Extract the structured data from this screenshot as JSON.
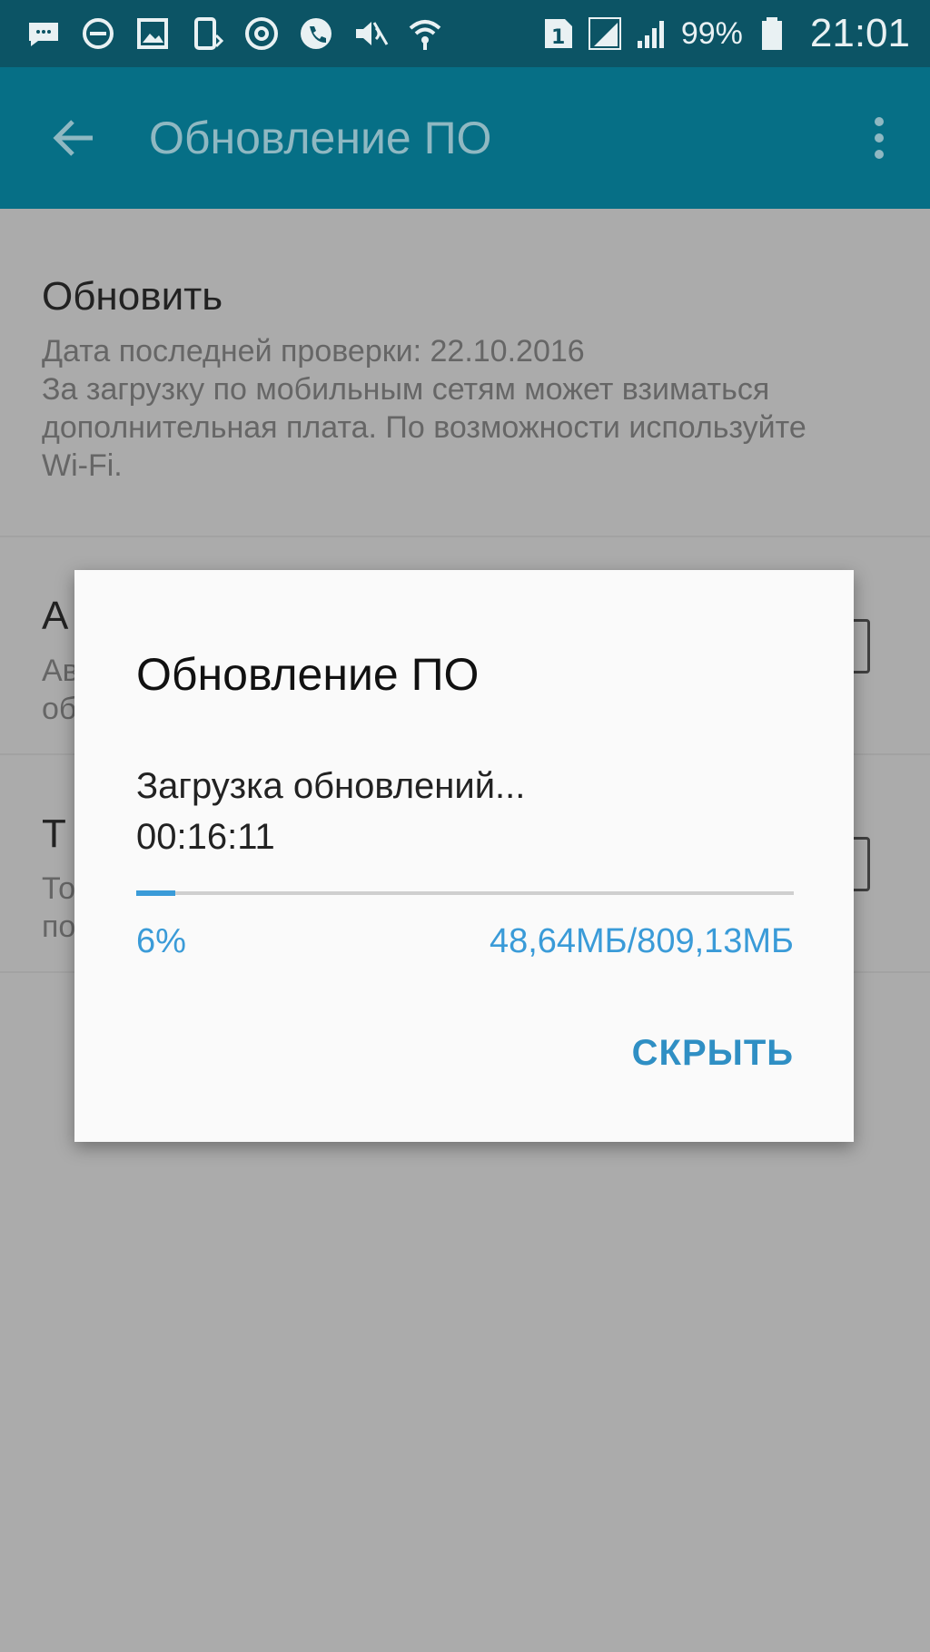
{
  "status_bar": {
    "icons": [
      "message-icon",
      "do-not-disturb-icon",
      "image-icon",
      "phone-sync-icon",
      "at-icon",
      "call-icon",
      "mute-icon",
      "wifi-icon",
      "sim1-icon",
      "signal-icon",
      "signal-icon"
    ],
    "battery_text": "99%",
    "time": "21:01"
  },
  "app_bar": {
    "title": "Обновление ПО"
  },
  "settings": [
    {
      "title": "Обновить",
      "description": "Дата последней проверки: 22.10.2016\nЗа загрузку по мобильным сетям может взиматься дополнительная плата. По возможности используйте Wi-Fi."
    },
    {
      "title": "А",
      "description": "Ав\nоб"
    },
    {
      "title": "Т",
      "description": "То\nпо"
    }
  ],
  "dialog": {
    "title": "Обновление ПО",
    "message": "Загрузка обновлений...",
    "elapsed": "00:16:11",
    "progress_fraction": 0.06,
    "percent_text": "6%",
    "size_text": "48,64МБ/809,13МБ",
    "hide_label": "СКРЫТЬ"
  },
  "colors": {
    "status_bar": "#0c5465",
    "app_bar": "#066f86",
    "accent": "#3a9bd8",
    "scrim_bg": "#ababab"
  }
}
